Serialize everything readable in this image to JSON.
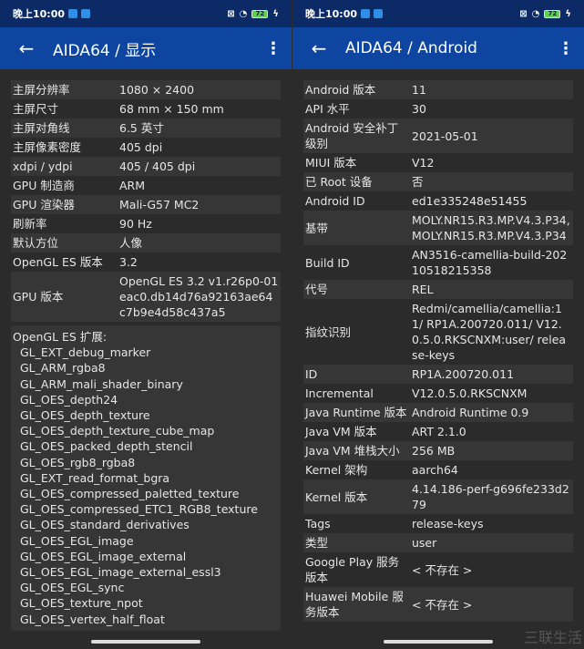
{
  "status": {
    "time": "晚上10:00",
    "battery": "72"
  },
  "left": {
    "title": "AIDA64  /  显示",
    "rows": [
      [
        "主屏分辨率",
        "1080 × 2400"
      ],
      [
        "主屏尺寸",
        "68 mm × 150 mm"
      ],
      [
        "主屏对角线",
        "6.5 英寸"
      ],
      [
        "主屏像素密度",
        "405 dpi"
      ],
      [
        "xdpi / ydpi",
        "405 / 405 dpi"
      ],
      [
        "GPU 制造商",
        "ARM"
      ],
      [
        "GPU 渲染器",
        "Mali-G57 MC2"
      ],
      [
        "刷新率",
        "90 Hz"
      ],
      [
        "默认方位",
        "人像"
      ],
      [
        "OpenGL ES 版本",
        "3.2"
      ],
      [
        "GPU 版本",
        "OpenGL ES 3.2 v1.r26p0-01eac0.db14d76a92163ae64c7b9e4d58c437a5"
      ]
    ],
    "ext_title": "OpenGL ES 扩展:",
    "extensions": [
      "GL_EXT_debug_marker",
      "GL_ARM_rgba8",
      "GL_ARM_mali_shader_binary",
      "GL_OES_depth24",
      "GL_OES_depth_texture",
      "GL_OES_depth_texture_cube_map",
      "GL_OES_packed_depth_stencil",
      "GL_OES_rgb8_rgba8",
      "GL_EXT_read_format_bgra",
      "GL_OES_compressed_paletted_texture",
      "GL_OES_compressed_ETC1_RGB8_texture",
      "GL_OES_standard_derivatives",
      "GL_OES_EGL_image",
      "GL_OES_EGL_image_external",
      "GL_OES_EGL_image_external_essl3",
      "GL_OES_EGL_sync",
      "GL_OES_texture_npot",
      "GL_OES_vertex_half_float"
    ]
  },
  "right": {
    "title": "AIDA64  /  Android",
    "rows": [
      [
        "Android 版本",
        "11"
      ],
      [
        "API 水平",
        "30"
      ],
      [
        "Android 安全补丁级别",
        "2021-05-01"
      ],
      [
        "MIUI 版本",
        "V12"
      ],
      [
        "已 Root 设备",
        "否"
      ],
      [
        "Android ID",
        "ed1e335248e51455"
      ],
      [
        "基带",
        "MOLY.NR15.R3.MP.V4.3.P34, MOLY.NR15.R3.MP.V4.3.P34"
      ],
      [
        "Build ID",
        "AN3516-camellia-build-20210518215358"
      ],
      [
        "代号",
        "REL"
      ],
      [
        "指纹识别",
        "Redmi/camellia/camellia:11/ RP1A.200720.011/ V12.0.5.0.RKSCNXM:user/ release-keys"
      ],
      [
        "ID",
        "RP1A.200720.011"
      ],
      [
        "Incremental",
        "V12.0.5.0.RKSCNXM"
      ],
      [
        "Java Runtime 版本",
        "Android Runtime 0.9"
      ],
      [
        "Java VM 版本",
        "ART 2.1.0"
      ],
      [
        "Java VM 堆栈大小",
        "256 MB"
      ],
      [
        "Kernel 架构",
        "aarch64"
      ],
      [
        "Kernel 版本",
        "4.14.186-perf-g696fe233d279"
      ],
      [
        "Tags",
        "release-keys"
      ],
      [
        "类型",
        "user"
      ],
      [
        "Google Play 服务版本",
        "< 不存在 >"
      ],
      [
        "Huawei Mobile 服务版本",
        "< 不存在 >"
      ]
    ]
  },
  "watermark": "三联生活"
}
